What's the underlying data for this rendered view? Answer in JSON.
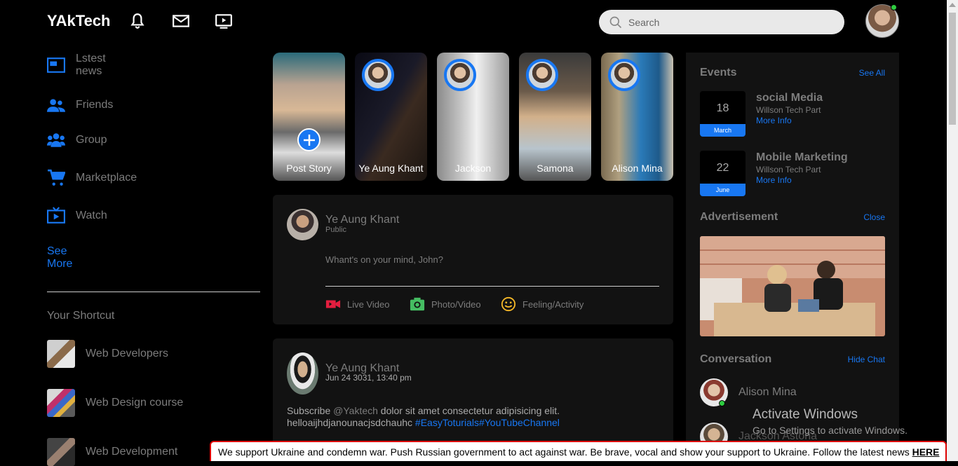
{
  "header": {
    "logo": "YAkTech",
    "icons": [
      "bell-icon",
      "mail-icon",
      "video-icon"
    ],
    "search_placeholder": "Search"
  },
  "sidebar": {
    "items": [
      {
        "label": "Lstest\nnews",
        "icon": "news-icon"
      },
      {
        "label": "Friends",
        "icon": "friends-icon"
      },
      {
        "label": "Group",
        "icon": "group-icon"
      },
      {
        "label": "Marketplace",
        "icon": "cart-icon"
      },
      {
        "label": "Watch",
        "icon": "watch-icon"
      }
    ],
    "see_more": "See More",
    "shortcut_title": "Your Shortcut",
    "shortcuts": [
      {
        "label": "Web Developers"
      },
      {
        "label": "Web Design course"
      },
      {
        "label": "Web Development"
      }
    ]
  },
  "stories": [
    {
      "name": "Post Story"
    },
    {
      "name": "Ye Aung Khant"
    },
    {
      "name": "Jackson"
    },
    {
      "name": "Samona"
    },
    {
      "name": "Alison Mina"
    }
  ],
  "composer": {
    "name": "Ye Aung Khant",
    "visibility": "Public",
    "prompt": "Whant's on your mind, John?",
    "actions": [
      {
        "label": "Live Video",
        "icon": "live-video-icon",
        "color": "#e41e3f"
      },
      {
        "label": "Photo/Video",
        "icon": "camera-icon",
        "color": "#45bd62"
      },
      {
        "label": "Feeling/Activity",
        "icon": "smile-icon",
        "color": "#f7b928"
      }
    ]
  },
  "post": {
    "name": "Ye Aung Khant",
    "date": "Jun 24 3031, 13:40 pm",
    "text_prefix": "Subscribe ",
    "mention": "@Yaktech",
    "text_body": " dolor sit amet consectetur adipisicing elit.",
    "text_line2": "helloaijhdjanounacjsdchauhc ",
    "hashtags": "#EasyToturials#YouTubeChannel"
  },
  "events": {
    "title": "Events",
    "see_all": "See All",
    "items": [
      {
        "day": "18",
        "month": "March",
        "title": "social Media",
        "place": "Willson Tech Part",
        "more": "More Info"
      },
      {
        "day": "22",
        "month": "June",
        "title": "Mobile Marketing",
        "place": "Willson Tech Part",
        "more": "More Info"
      }
    ]
  },
  "advertisement": {
    "title": "Advertisement",
    "close": "Close"
  },
  "conversation": {
    "title": "Conversation",
    "hide": "Hide Chat",
    "people": [
      {
        "name": "Alison Mina",
        "online": true
      },
      {
        "name": "Jackson Astona",
        "online": false
      }
    ]
  },
  "windows": {
    "activate_title": "Activate Windows",
    "activate_sub": "Go to Settings to activate Windows."
  },
  "banner": {
    "text": "We support Ukraine and condemn war. Push Russian government to act against war. Be brave, vocal and show your support to Ukraine. Follow the latest news ",
    "link": "HERE"
  },
  "colors": {
    "accent": "#1877f2",
    "background": "#000000",
    "card": "#121212"
  }
}
